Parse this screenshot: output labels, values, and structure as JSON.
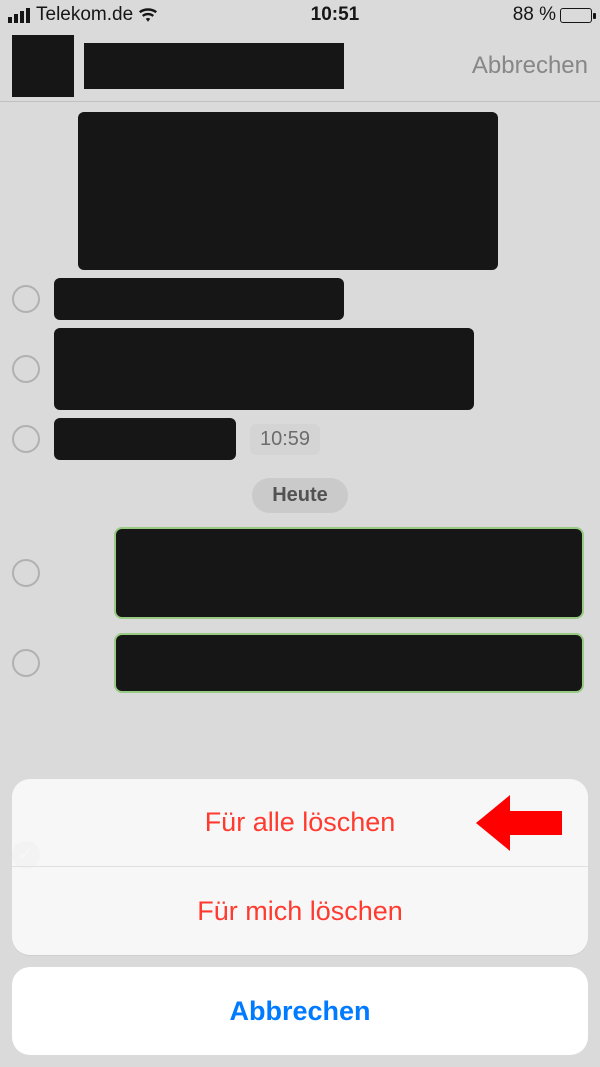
{
  "statusbar": {
    "carrier": "Telekom.de",
    "time": "10:51",
    "battery_pct": "88 %"
  },
  "header": {
    "cancel": "Abbrechen"
  },
  "chat": {
    "time_label": "10:59",
    "date_label": "Heute"
  },
  "sheet": {
    "delete_for_all": "Für alle löschen",
    "delete_for_me": "Für mich löschen",
    "cancel": "Abbrechen"
  }
}
